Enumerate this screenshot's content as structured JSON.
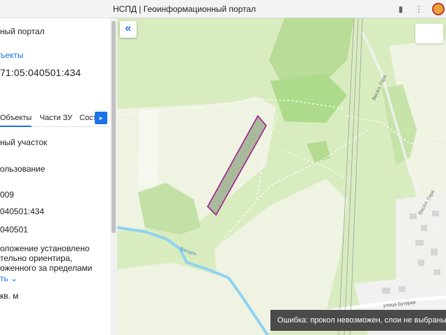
{
  "window": {
    "title": "НСПД | Геоинформационный портал"
  },
  "sidebar": {
    "portal_title": "ный портал",
    "objects_link": "ъекты",
    "cadastral_number": "71:05:040501:434",
    "tabs": [
      {
        "label": "Объекты"
      },
      {
        "label": "Части ЗУ"
      },
      {
        "label": "Соста"
      }
    ],
    "fields": [
      {
        "value": "ный участок"
      },
      {
        "value": "ользование"
      },
      {
        "value": "009"
      },
      {
        "value": "040501:434"
      },
      {
        "value": "040501"
      },
      {
        "value": "оложение установлено"
      },
      {
        "value": "тельно ориентира,"
      },
      {
        "value": "оженного за пределами"
      },
      {
        "value": "ть"
      },
      {
        "value": "кв. м"
      }
    ]
  },
  "map": {
    "labels": {
      "road_north": "Весёл. Гора",
      "road_east": "Весёл. Гора",
      "river": "Вандея",
      "street": "улица Бутарки"
    },
    "toast": "Ошибка: прокол невозможен, слои не выбраны",
    "colors": {
      "forest": "#b9dc96",
      "field": "#eef3e2",
      "river": "#8fd3f2",
      "parcel_border": "#a0208a",
      "parcel_fill": "#a9b99b"
    }
  }
}
